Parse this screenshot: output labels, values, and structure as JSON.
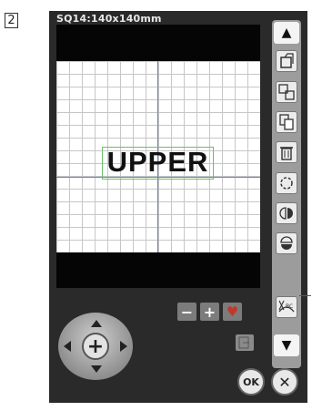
{
  "step": {
    "number": "2"
  },
  "screen": {
    "hoop_label": "SQ14:140x140mm",
    "pattern_text": "UPPER"
  },
  "sidebar": {
    "scroll_up": "▲",
    "scroll_down": "▼",
    "tools": [
      {
        "name": "layout-icon"
      },
      {
        "name": "group-icon"
      },
      {
        "name": "duplicate-icon"
      },
      {
        "name": "delete-icon"
      },
      {
        "name": "rotate-icon"
      },
      {
        "name": "mirror-horizontal-icon"
      },
      {
        "name": "mirror-vertical-icon"
      },
      {
        "name": "arc-text-icon"
      }
    ]
  },
  "size_controls": {
    "minus": "−",
    "plus": "+",
    "heart": "♥"
  },
  "dpad": {
    "center": "+"
  },
  "buttons": {
    "ok": "OK",
    "cancel": "✕"
  },
  "colors": {
    "accent_green": "#6bbf6b",
    "axis_blue": "#6c7fb8",
    "heart_red": "#c0392b"
  }
}
